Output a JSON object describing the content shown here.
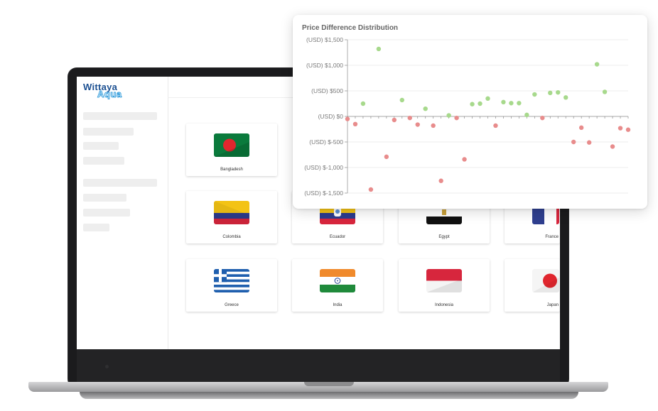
{
  "brand": {
    "logo_top": "Wittaya",
    "logo_bottom": "Aqua"
  },
  "countries": [
    {
      "name": "Bangladesh"
    },
    {
      "name": "Colombia"
    },
    {
      "name": "Ecuador"
    },
    {
      "name": "Egypt"
    },
    {
      "name": "France"
    },
    {
      "name": "Greece"
    },
    {
      "name": "India"
    },
    {
      "name": "Indonesia"
    },
    {
      "name": "Japan"
    }
  ],
  "chart_data": {
    "type": "scatter",
    "title": "Price Difference Distribution",
    "ylabel": "",
    "xlabel": "",
    "ylim": [
      -1500,
      1500
    ],
    "y_ticks": [
      1500,
      1000,
      500,
      0,
      -500,
      -1000,
      -1500
    ],
    "y_tick_labels": [
      "(USD) $1,500",
      "(USD) $1,000",
      "(USD) $500",
      "(USD) $0",
      "(USD) $-500",
      "(USD) $-1,000",
      "(USD) $-1,500"
    ],
    "grid": true,
    "colors": {
      "positive": "#a7d98c",
      "negative": "#e88c8c"
    },
    "series": [
      {
        "values": [
          -50,
          -150,
          250,
          -1430,
          1320,
          -790,
          -70,
          320,
          -30,
          -160,
          150,
          -180,
          -1260,
          20,
          -30,
          -840,
          240,
          250,
          350,
          -180,
          280,
          260,
          260,
          30,
          430,
          -30,
          460,
          470,
          370,
          -500,
          -220,
          -510,
          1020,
          480,
          -590,
          -230,
          -260
        ]
      }
    ]
  }
}
